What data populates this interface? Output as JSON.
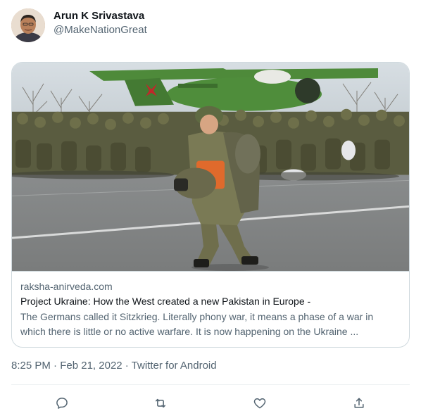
{
  "user": {
    "display_name": "Arun K Srivastava",
    "handle": "@MakeNationGreat"
  },
  "card": {
    "domain": "raksha-anirveda.com",
    "title": "Project Ukraine: How the West created a new Pakistan in Europe -",
    "description": "The Germans called it Sitzkrieg. Literally phony war, it means a phase of a war in which there is little or no active warfare. It is now happening on the Ukraine ..."
  },
  "meta": {
    "time": "8:25 PM",
    "separator": "·",
    "date": "Feb 21, 2022",
    "source": "Twitter for Android"
  },
  "actions": {
    "icons": [
      "reply-icon",
      "retweet-icon",
      "like-icon",
      "share-icon"
    ]
  },
  "colors": {
    "secondary_text": "#536471",
    "border": "#cfd9de",
    "plane_green": "#4e8a3a"
  }
}
